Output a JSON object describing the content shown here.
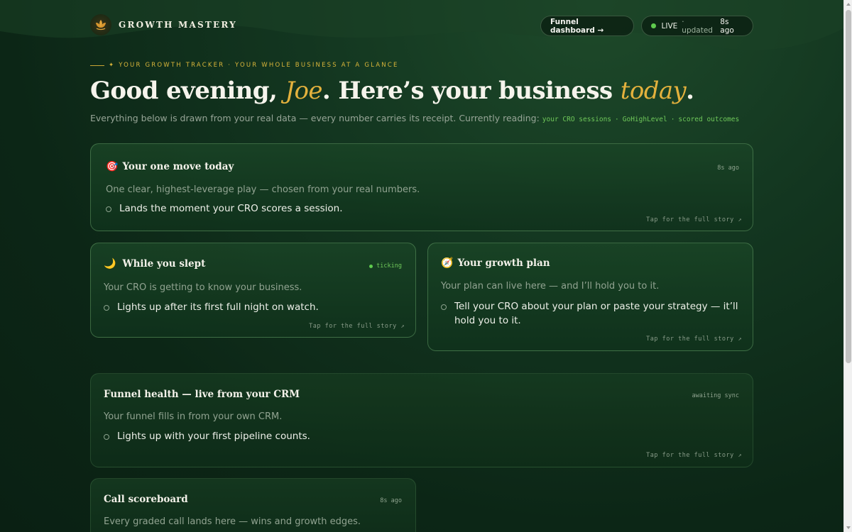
{
  "header": {
    "brand": "GROWTH MASTERY",
    "funnel_button": "Funnel dashboard →",
    "live": {
      "label": "LIVE",
      "updated": "· updated",
      "ago": "8s ago"
    }
  },
  "hero": {
    "eyebrow": "✦ YOUR GROWTH TRACKER · YOUR WHOLE BUSINESS AT A GLANCE",
    "greeting": "Good evening, ",
    "name": "Joe",
    "middle": ". Here’s your business ",
    "today": "today",
    "period": ".",
    "subline": "Everything below is drawn from your real data — every number carries its receipt. Currently reading:",
    "sources": [
      "your CRO sessions",
      "GoHighLevel",
      "scored outcomes"
    ],
    "source_sep": "·"
  },
  "cards": {
    "one_move": {
      "emoji": "🎯",
      "title": "Your one move today",
      "meta": "8s ago",
      "desc": "One clear, highest-leverage play — chosen from your real numbers.",
      "item": "Lands the moment your CRO scores a session.",
      "foot": "Tap for the full story ↗"
    },
    "slept": {
      "emoji": "🌙",
      "title": "While you slept",
      "meta": "ticking",
      "desc": "Your CRO is getting to know your business.",
      "item": "Lights up after its first full night on watch.",
      "foot": "Tap for the full story ↗"
    },
    "plan": {
      "emoji": "🧭",
      "title": "Your growth plan",
      "desc": "Your plan can live here — and I’ll hold you to it.",
      "item_line1": "Tell your CRO about your plan or paste your strategy — it’ll",
      "item_line2": "hold you to it.",
      "foot": "Tap for the full story ↗"
    },
    "funnel": {
      "title": "Funnel health — live from your CRM",
      "meta": "awaiting sync",
      "desc": "Your funnel fills in from your own CRM.",
      "item": "Lights up with your first pipeline counts.",
      "foot": "Tap for the full story ↗"
    },
    "scoreboard": {
      "title": "Call scoreboard",
      "meta": "8s ago",
      "desc": "Every graded call lands here — wins and growth edges."
    }
  },
  "colors": {
    "accent_gold": "#e3b13d",
    "live_green": "#5fcb4e",
    "source_green": "#6fc85a"
  },
  "icons": {
    "logo": "lotus-icon",
    "live": "status-dot-icon"
  }
}
